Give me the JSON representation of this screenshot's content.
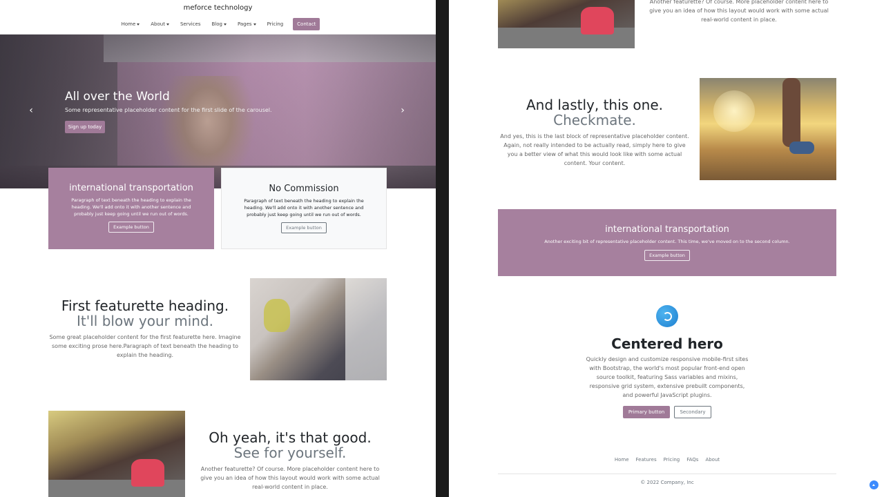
{
  "navbar": {
    "brand": "meforce technology",
    "items": [
      {
        "label": "Home",
        "caret": true
      },
      {
        "label": "About",
        "caret": true
      },
      {
        "label": "Services",
        "caret": false
      },
      {
        "label": "Blog",
        "caret": true
      },
      {
        "label": "Pages",
        "caret": true
      },
      {
        "label": "Pricing",
        "caret": false
      },
      {
        "label": "Contact",
        "caret": false
      }
    ]
  },
  "carousel": {
    "title": "All over the World",
    "text": "Some representative placeholder content for the first slide of the carousel.",
    "button": "Sign up today",
    "prev_icon": "chevron-left-icon",
    "next_icon": "chevron-right-icon"
  },
  "cards": [
    {
      "title": "international transportation",
      "text": "Paragraph of text beneath the heading to explain the heading. We'll add onto it with another sentence and probably just keep going until we run out of words.",
      "button": "Example button"
    },
    {
      "title": "No Commission",
      "text": "Paragraph of text beneath the heading to explain the heading. We'll add onto it with another sentence and probably just keep going until we run out of words.",
      "button": "Example button"
    }
  ],
  "featurette1": {
    "heading": "First featurette heading.",
    "muted": "It'll blow your mind.",
    "text": "Some great placeholder content for the first featurette here. Imagine some exciting prose here.Paragraph of text beneath the heading to explain the heading."
  },
  "featurette2": {
    "heading": "Oh yeah, it's that good.",
    "muted": "See for yourself.",
    "text": "Another featurette? Of course. More placeholder content here to give you an idea of how this layout would work with some actual real-world content in place."
  },
  "featurette3": {
    "heading": "And lastly, this one.",
    "muted": "Checkmate.",
    "text": "And yes, this is the last block of representative placeholder content. Again, not really intended to be actually read, simply here to give you a better view of what this would look like with some actual content. Your content."
  },
  "band": {
    "title": "international transportation",
    "text": "Another exciting bit of representative placeholder content. This time, we've moved on to the second column.",
    "button": "Example button"
  },
  "centered_hero": {
    "icon": "bootstrap-logo-icon",
    "title": "Centered hero",
    "text": "Quickly design and customize responsive mobile-first sites with Bootstrap, the world's most popular front-end open source toolkit, featuring Sass variables and mixins, responsive grid system, extensive prebuilt components, and powerful JavaScript plugins.",
    "primary": "Primary button",
    "secondary": "Secondary"
  },
  "footer": {
    "links": [
      "Home",
      "Features",
      "Pricing",
      "FAQs",
      "About"
    ],
    "copyright": "© 2022 Company, Inc"
  },
  "colors": {
    "accent": "#a07a98",
    "card_accent": "#a6809e",
    "divider": "#1b1b1b"
  }
}
